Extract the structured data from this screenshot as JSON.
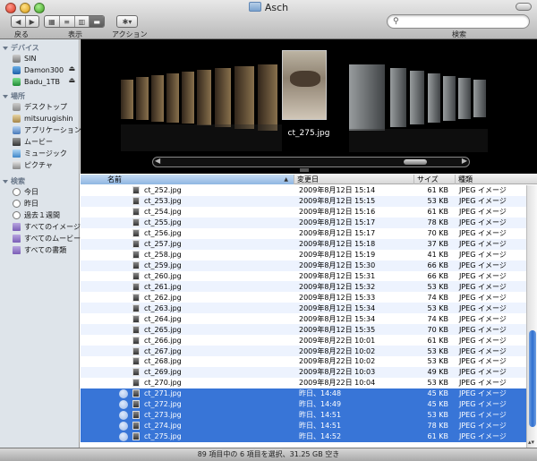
{
  "window": {
    "title": "Asch"
  },
  "toolbar": {
    "back_label": "戻る",
    "view_label": "表示",
    "action_label": "アクション",
    "search_label": "検索",
    "search_placeholder": ""
  },
  "sidebar": {
    "devices_header": "デバイス",
    "devices": [
      {
        "label": "SIN",
        "icon": "disk-icon"
      },
      {
        "label": "Damon300",
        "icon": "disk-icon",
        "eject": "⏏"
      },
      {
        "label": "Badu_1TB",
        "icon": "disk-icon",
        "eject": "⏏"
      }
    ],
    "places_header": "場所",
    "places": [
      {
        "label": "デスクトップ",
        "icon": "desktop-icon"
      },
      {
        "label": "mitsurugishin",
        "icon": "home-icon"
      },
      {
        "label": "アプリケーション",
        "icon": "applications-icon"
      },
      {
        "label": "ムービー",
        "icon": "movies-icon"
      },
      {
        "label": "ミュージック",
        "icon": "music-icon"
      },
      {
        "label": "ピクチャ",
        "icon": "pictures-icon"
      }
    ],
    "search_header": "検索",
    "searches": [
      {
        "label": "今日",
        "icon": "clock-icon"
      },
      {
        "label": "昨日",
        "icon": "clock-icon"
      },
      {
        "label": "過去１週間",
        "icon": "clock-icon"
      },
      {
        "label": "すべてのイメージ",
        "icon": "smart-folder-icon"
      },
      {
        "label": "すべてのムービー",
        "icon": "smart-folder-icon"
      },
      {
        "label": "すべての書類",
        "icon": "smart-folder-icon"
      }
    ]
  },
  "coverflow": {
    "caption": "ct_275.jpg"
  },
  "list": {
    "headers": {
      "name": "名前",
      "date": "変更日",
      "size": "サイズ",
      "kind": "種類"
    },
    "rows": [
      {
        "name": "ct_252.jpg",
        "date": "2009年8月12日 15:14",
        "size": "61 KB",
        "kind": "JPEG イメージ",
        "selected": false
      },
      {
        "name": "ct_253.jpg",
        "date": "2009年8月12日 15:15",
        "size": "53 KB",
        "kind": "JPEG イメージ",
        "selected": false
      },
      {
        "name": "ct_254.jpg",
        "date": "2009年8月12日 15:16",
        "size": "61 KB",
        "kind": "JPEG イメージ",
        "selected": false
      },
      {
        "name": "ct_255.jpg",
        "date": "2009年8月12日 15:17",
        "size": "78 KB",
        "kind": "JPEG イメージ",
        "selected": false
      },
      {
        "name": "ct_256.jpg",
        "date": "2009年8月12日 15:17",
        "size": "70 KB",
        "kind": "JPEG イメージ",
        "selected": false
      },
      {
        "name": "ct_257.jpg",
        "date": "2009年8月12日 15:18",
        "size": "37 KB",
        "kind": "JPEG イメージ",
        "selected": false
      },
      {
        "name": "ct_258.jpg",
        "date": "2009年8月12日 15:19",
        "size": "41 KB",
        "kind": "JPEG イメージ",
        "selected": false
      },
      {
        "name": "ct_259.jpg",
        "date": "2009年8月12日 15:30",
        "size": "66 KB",
        "kind": "JPEG イメージ",
        "selected": false
      },
      {
        "name": "ct_260.jpg",
        "date": "2009年8月12日 15:31",
        "size": "66 KB",
        "kind": "JPEG イメージ",
        "selected": false
      },
      {
        "name": "ct_261.jpg",
        "date": "2009年8月12日 15:32",
        "size": "53 KB",
        "kind": "JPEG イメージ",
        "selected": false
      },
      {
        "name": "ct_262.jpg",
        "date": "2009年8月12日 15:33",
        "size": "74 KB",
        "kind": "JPEG イメージ",
        "selected": false
      },
      {
        "name": "ct_263.jpg",
        "date": "2009年8月12日 15:34",
        "size": "53 KB",
        "kind": "JPEG イメージ",
        "selected": false
      },
      {
        "name": "ct_264.jpg",
        "date": "2009年8月12日 15:34",
        "size": "74 KB",
        "kind": "JPEG イメージ",
        "selected": false
      },
      {
        "name": "ct_265.jpg",
        "date": "2009年8月12日 15:35",
        "size": "70 KB",
        "kind": "JPEG イメージ",
        "selected": false
      },
      {
        "name": "ct_266.jpg",
        "date": "2009年8月22日 10:01",
        "size": "61 KB",
        "kind": "JPEG イメージ",
        "selected": false
      },
      {
        "name": "ct_267.jpg",
        "date": "2009年8月22日 10:02",
        "size": "53 KB",
        "kind": "JPEG イメージ",
        "selected": false
      },
      {
        "name": "ct_268.jpg",
        "date": "2009年8月22日 10:02",
        "size": "53 KB",
        "kind": "JPEG イメージ",
        "selected": false
      },
      {
        "name": "ct_269.jpg",
        "date": "2009年8月22日 10:03",
        "size": "49 KB",
        "kind": "JPEG イメージ",
        "selected": false
      },
      {
        "name": "ct_270.jpg",
        "date": "2009年8月22日 10:04",
        "size": "53 KB",
        "kind": "JPEG イメージ",
        "selected": false
      },
      {
        "name": "ct_271.jpg",
        "date": "昨日、14:48",
        "size": "45 KB",
        "kind": "JPEG イメージ",
        "selected": true
      },
      {
        "name": "ct_272.jpg",
        "date": "昨日、14:49",
        "size": "45 KB",
        "kind": "JPEG イメージ",
        "selected": true
      },
      {
        "name": "ct_273.jpg",
        "date": "昨日、14:51",
        "size": "53 KB",
        "kind": "JPEG イメージ",
        "selected": true
      },
      {
        "name": "ct_274.jpg",
        "date": "昨日、14:51",
        "size": "78 KB",
        "kind": "JPEG イメージ",
        "selected": true
      },
      {
        "name": "ct_275.jpg",
        "date": "昨日、14:52",
        "size": "61 KB",
        "kind": "JPEG イメージ",
        "selected": true
      }
    ]
  },
  "status": {
    "text": "89 項目中の 6 項目を選択、31.25 GB 空き"
  },
  "colors": {
    "selection": "#3875d7",
    "sidebar_bg": "#dee4ea"
  }
}
